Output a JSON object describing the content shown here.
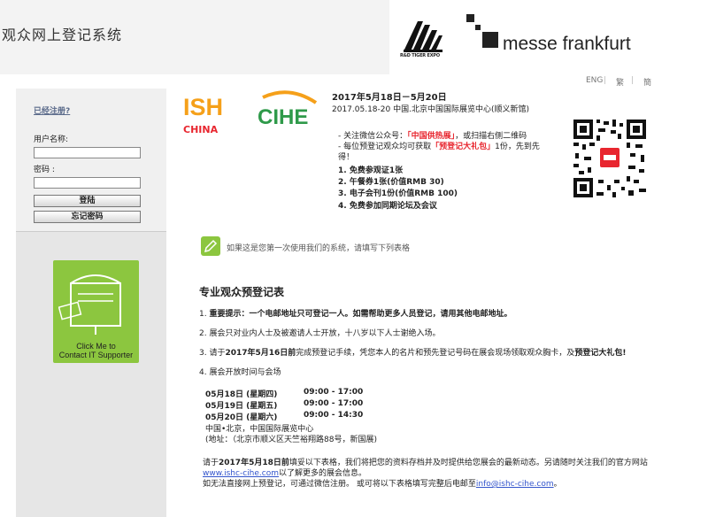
{
  "header": {
    "system_title": "观众网上登记系统",
    "rd_logo_text": "R&D TIGER EXPO",
    "mf_logo_text": "messe frankfurt"
  },
  "lang": {
    "eng": "ENG",
    "trad": "繁",
    "simp": "簡",
    "sep": "|"
  },
  "login": {
    "registered_link": "已经注册?",
    "username_label": "用户名称:",
    "username_value": "",
    "password_label": "密码 :",
    "password_value": "",
    "login_button": "登陆",
    "forgot_button": "忘记密码"
  },
  "it_support": {
    "line1": "Click Me to",
    "line2": "Contact IT Supporter"
  },
  "event": {
    "logo_ish": "ISH",
    "logo_ish_sub": "CHINA",
    "logo_cihe": "CIHE",
    "date_title": "2017年5月18日－5月20日",
    "place": "2017.05.18-20 中国.北京中国国际展览中心(顺义新馆)",
    "tip1_a": "- 关注微信公众号：",
    "tip1_red": "「中国供热展」",
    "tip1_b": "，或扫描右侧二维码",
    "tip2_a": "- 每位预登记观众均可获取",
    "tip2_red": "「预登记大礼包」",
    "tip2_b": "1份，先到先",
    "tip2_c": "得！",
    "perks": [
      "1. 免费参观证1张",
      "2. 午餐券1张(价值RMB 30)",
      "3. 电子会刊1份(价值RMB 100)",
      "4. 免费参加同期论坛及会议"
    ]
  },
  "first_time": "如果这是您第一次使用我们的系统，请填写下列表格",
  "form": {
    "title": "专业观众预登记表",
    "note1_num": "1. ",
    "note1_bold": "重要提示：一个电邮地址只可登记一人。如需帮助更多人员登记，请用其他电邮地址。",
    "note2": "2. 展会只对业内人士及被邀请人士开放，十八岁以下人士谢绝入场。",
    "note3_a": "3. 请于",
    "note3_b": "2017年5月16日前",
    "note3_c": "完成预登记手续，凭您本人的名片和预先登记号码在展会现场领取观众胸卡，及",
    "note3_d": "预登记大礼包!",
    "note4": "4. 展会开放时间与会场",
    "schedule": [
      {
        "day": "05月18日 (星期四)",
        "time": "09:00 - 17:00"
      },
      {
        "day": "05月19日 (星期五)",
        "time": "09:00 - 17:00"
      },
      {
        "day": "05月20日 (星期六)",
        "time": "09:00 - 14:30"
      }
    ],
    "venue": "中国•北京，中国国际展览中心",
    "address": "(地址：（北京市顺义区天竺裕翔路88号，新国展)"
  },
  "footer": {
    "line1_a": "请于",
    "line1_b": "2017年5月18日前",
    "line1_c": "填妥以下表格，我们将把您的资料存档并及时提供给您展会的最新动态。另请随时关注我们的官方网站",
    "website": "www.ishc-cihe.com",
    "line2": "以了解更多的展会信息。",
    "line3": "如无法直接网上预登记，可通过微信注册。 或可将以下表格填写完整后电邮至",
    "email": "info@ishc-cihe.com",
    "line3_end": "。"
  },
  "colors": {
    "accent_green": "#8cc63f",
    "ish_red": "#e8262f",
    "cihe_green": "#2f9a4a",
    "link_blue": "#3355cc"
  }
}
